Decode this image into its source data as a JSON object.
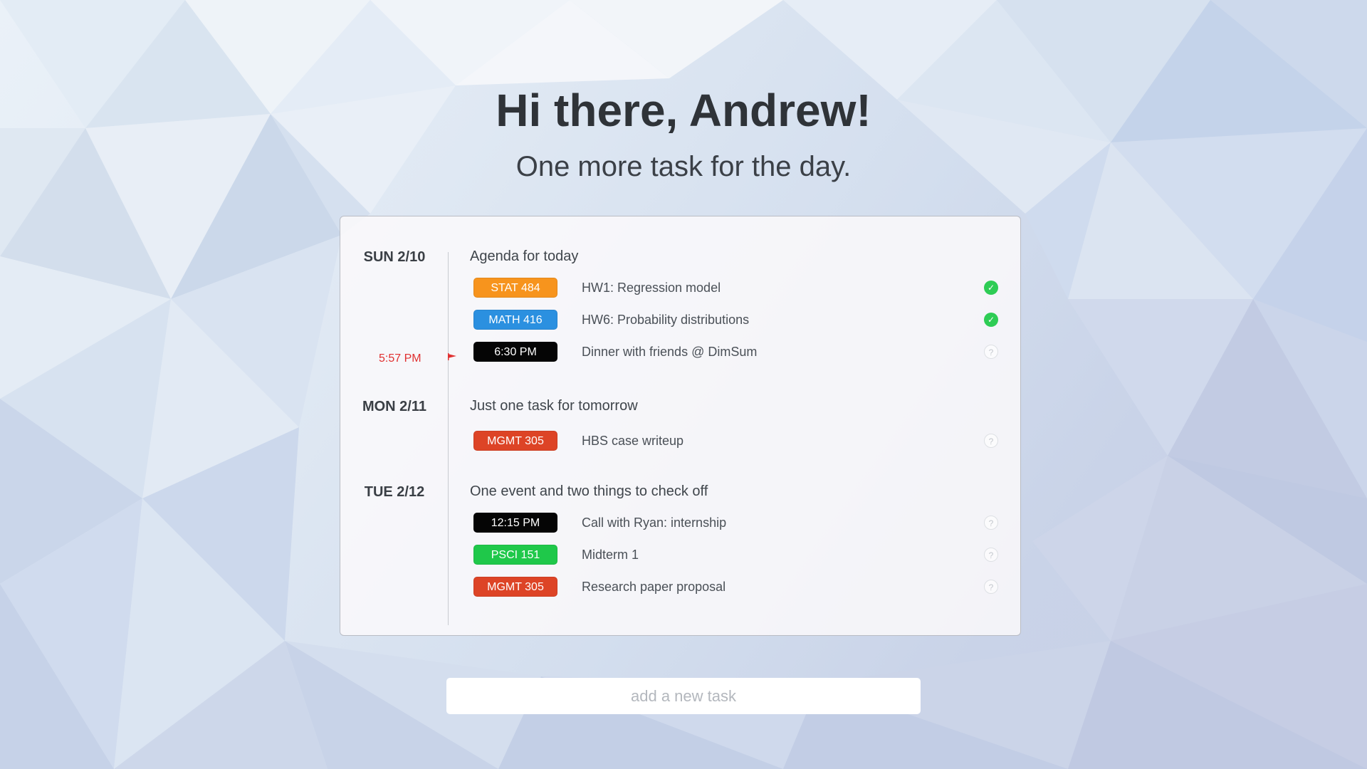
{
  "header": {
    "greeting": "Hi there, Andrew!",
    "subtitle": "One more task for the day."
  },
  "now_marker": {
    "time": "5:57 PM",
    "color": "#e03030"
  },
  "days": [
    {
      "label": "SUN 2/10",
      "heading": "Agenda for today",
      "tasks": [
        {
          "tag": "STAT 484",
          "tag_color": "#f7941d",
          "text": "HW1: Regression model",
          "status": "done",
          "status_icon": "check-icon"
        },
        {
          "tag": "MATH 416",
          "tag_color": "#2b90e0",
          "text": "HW6: Probability distributions",
          "status": "done",
          "status_icon": "check-icon"
        },
        {
          "tag": "6:30 PM",
          "tag_color": "#050505",
          "text": "Dinner with friends @ DimSum",
          "status": "pending",
          "status_icon": "question-icon"
        }
      ]
    },
    {
      "label": "MON 2/11",
      "heading": "Just one task for tomorrow",
      "tasks": [
        {
          "tag": "MGMT 305",
          "tag_color": "#dd4426",
          "text": "HBS case writeup",
          "status": "pending",
          "status_icon": "question-icon"
        }
      ]
    },
    {
      "label": "TUE 2/12",
      "heading": "One event and two things to check off",
      "tasks": [
        {
          "tag": "12:15 PM",
          "tag_color": "#050505",
          "text": "Call with Ryan: internship",
          "status": "pending",
          "status_icon": "question-icon"
        },
        {
          "tag": "PSCI 151",
          "tag_color": "#1fc84a",
          "text": "Midterm 1",
          "status": "pending",
          "status_icon": "question-icon"
        },
        {
          "tag": "MGMT 305",
          "tag_color": "#dd4426",
          "text": "Research paper proposal",
          "status": "pending",
          "status_icon": "question-icon"
        }
      ]
    }
  ],
  "status_symbols": {
    "done": "✓",
    "pending": "?"
  },
  "add_task": {
    "placeholder": "add a new task",
    "value": ""
  }
}
